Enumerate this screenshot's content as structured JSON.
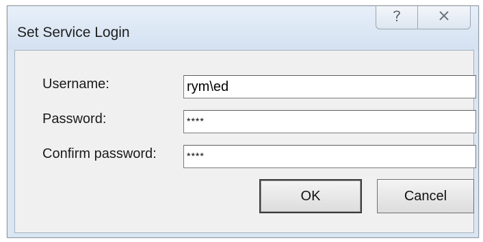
{
  "window": {
    "title": "Set Service Login",
    "help_icon": "question-mark-icon",
    "close_icon": "close-x-icon"
  },
  "form": {
    "username_label": "Username:",
    "username_value": "rym\\ed",
    "password_label": "Password:",
    "password_value": "****",
    "confirm_label": "Confirm password:",
    "confirm_value": "****"
  },
  "buttons": {
    "ok_label": "OK",
    "cancel_label": "Cancel"
  },
  "colors": {
    "titlebar": "#dbe6f3",
    "client": "#f0f0f0"
  }
}
